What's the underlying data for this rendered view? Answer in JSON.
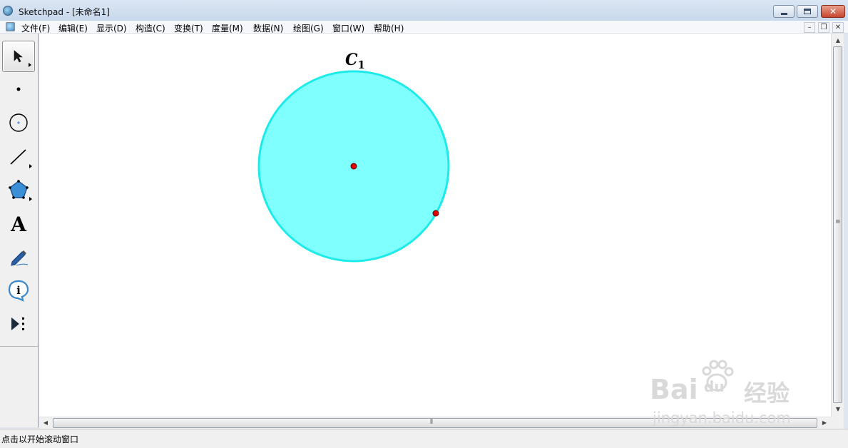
{
  "window": {
    "title": "Sketchpad  - [未命名1]"
  },
  "menu": {
    "items": [
      "文件(F)",
      "编辑(E)",
      "显示(D)",
      "构造(C)",
      "变换(T)",
      "度量(M)",
      "数据(N)",
      "绘图(G)",
      "窗口(W)",
      "帮助(H)"
    ]
  },
  "toolbox": {
    "tools": [
      {
        "name": "selection-arrow-tool",
        "icon": "arrow-cursor-icon",
        "active": true
      },
      {
        "name": "point-tool",
        "icon": "point-icon"
      },
      {
        "name": "compass-tool",
        "icon": "circle-icon"
      },
      {
        "name": "straightedge-tool",
        "icon": "segment-icon"
      },
      {
        "name": "polygon-tool",
        "icon": "pentagon-icon"
      },
      {
        "name": "text-tool",
        "icon": "text-a-icon",
        "glyph": "A"
      },
      {
        "name": "marker-tool",
        "icon": "pen-icon"
      },
      {
        "name": "information-tool",
        "icon": "info-icon"
      },
      {
        "name": "custom-tool",
        "icon": "play-custom-icon"
      }
    ]
  },
  "canvas": {
    "circle": {
      "label": "C",
      "label_subscript": "1",
      "fill_color": "#80ffff",
      "stroke_color": "#1eeaea"
    },
    "points_color": "#e00000"
  },
  "status": {
    "text": "点击以开始滚动窗口"
  },
  "watermark": {
    "line1_latin": "Bai",
    "line1_du": "du",
    "line1_cn": "经验",
    "line2": "jingyan.baidu.com"
  }
}
